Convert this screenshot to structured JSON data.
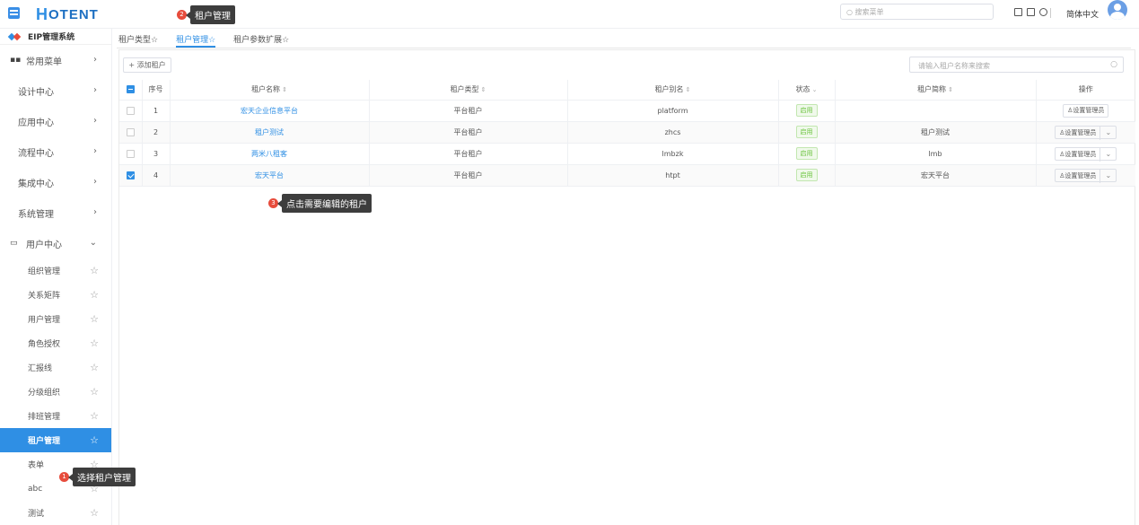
{
  "app": {
    "logo_h": "H",
    "logo_rest": "OTENT",
    "search_placeholder": "搜索菜单",
    "language": "简体中文"
  },
  "sidebar": {
    "system_name": "EIP管理系统",
    "top_items": [
      {
        "label": "常用菜单",
        "icon": "grid-icon"
      },
      {
        "label": "设计中心"
      },
      {
        "label": "应用中心"
      },
      {
        "label": "流程中心"
      },
      {
        "label": "集成中心"
      },
      {
        "label": "系统管理"
      },
      {
        "label": "用户中心",
        "icon": "monitor-icon",
        "expanded": true
      }
    ],
    "sub_items": [
      {
        "label": "组织管理"
      },
      {
        "label": "关系矩阵"
      },
      {
        "label": "用户管理"
      },
      {
        "label": "角色授权"
      },
      {
        "label": "汇报线"
      },
      {
        "label": "分级组织"
      },
      {
        "label": "排班管理"
      },
      {
        "label": "租户管理",
        "active": true
      },
      {
        "label": "表单"
      },
      {
        "label": "abc"
      },
      {
        "label": "测试"
      }
    ]
  },
  "tabs": [
    {
      "label": "租户类型☆"
    },
    {
      "label": "租户管理☆",
      "active": true
    },
    {
      "label": "租户参数扩展☆"
    }
  ],
  "toolbar": {
    "add_label": "+ 添加租户",
    "search_placeholder": "请输入租户名称来搜索"
  },
  "table": {
    "headers": {
      "seq": "序号",
      "name": "租户名称",
      "type": "租户类型",
      "alias": "租户别名",
      "status": "状态",
      "short": "租户简称",
      "ops": "操作"
    },
    "rows": [
      {
        "seq": "1",
        "name": "宏天企业信息平台",
        "type": "平台租户",
        "alias": "platform",
        "status": "启用",
        "short": "",
        "op": "设置管理员",
        "has_dropdown": false,
        "checked": false
      },
      {
        "seq": "2",
        "name": "租户测试",
        "type": "平台租户",
        "alias": "zhcs",
        "status": "启用",
        "short": "租户测试",
        "op": "设置管理员",
        "has_dropdown": true,
        "checked": false
      },
      {
        "seq": "3",
        "name": "两米八租客",
        "type": "平台租户",
        "alias": "lmbzk",
        "status": "启用",
        "short": "lmb",
        "op": "设置管理员",
        "has_dropdown": true,
        "checked": false
      },
      {
        "seq": "4",
        "name": "宏天平台",
        "type": "平台租户",
        "alias": "htpt",
        "status": "启用",
        "short": "宏天平台",
        "op": "设置管理员",
        "has_dropdown": true,
        "checked": true
      }
    ]
  },
  "tips": [
    {
      "num": "1",
      "text": "选择租户管理"
    },
    {
      "num": "2",
      "text": "租户管理"
    },
    {
      "num": "3",
      "text": "点击需要编辑的租户"
    }
  ],
  "colors": {
    "accent": "#2f8fe4",
    "tip_badge": "#e74c3c",
    "status_green": "#67c23a"
  }
}
